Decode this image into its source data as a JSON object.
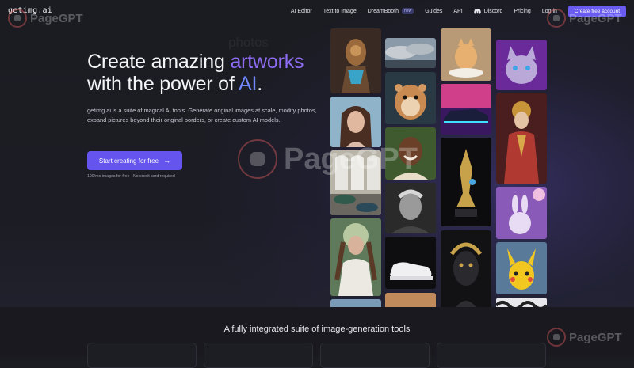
{
  "nav": {
    "logo": "getimg.ai",
    "links": [
      "AI Editor",
      "Text to Image",
      "DreamBooth",
      "Guides",
      "API",
      "Discord",
      "Pricing",
      "Log in"
    ],
    "new_badge": "new",
    "cta": "Create free account"
  },
  "hero": {
    "title_line1_prefix": "Create amazing ",
    "title_line1_accent": "artworks",
    "title_line2_prefix": "with the power of ",
    "title_line2_accent": "AI",
    "title_line2_suffix": ".",
    "description": "getimg.ai is a suite of magical AI tools. Generate original images at scale, modify photos, expand pictures beyond their original borders, or create custom AI models.",
    "button_label": "Start creating for free",
    "note": "100/mo images for free · No credit card required"
  },
  "ghost_word": "photos",
  "watermark": "PageGPT",
  "bottom": {
    "title": "A fully integrated suite of image-generation tools"
  },
  "icons": {
    "arrow": "arrow-right-icon",
    "discord": "discord-icon"
  },
  "colors": {
    "accent": "#8e6cf6",
    "button": "#6554ee",
    "background": "#1b1c22"
  }
}
